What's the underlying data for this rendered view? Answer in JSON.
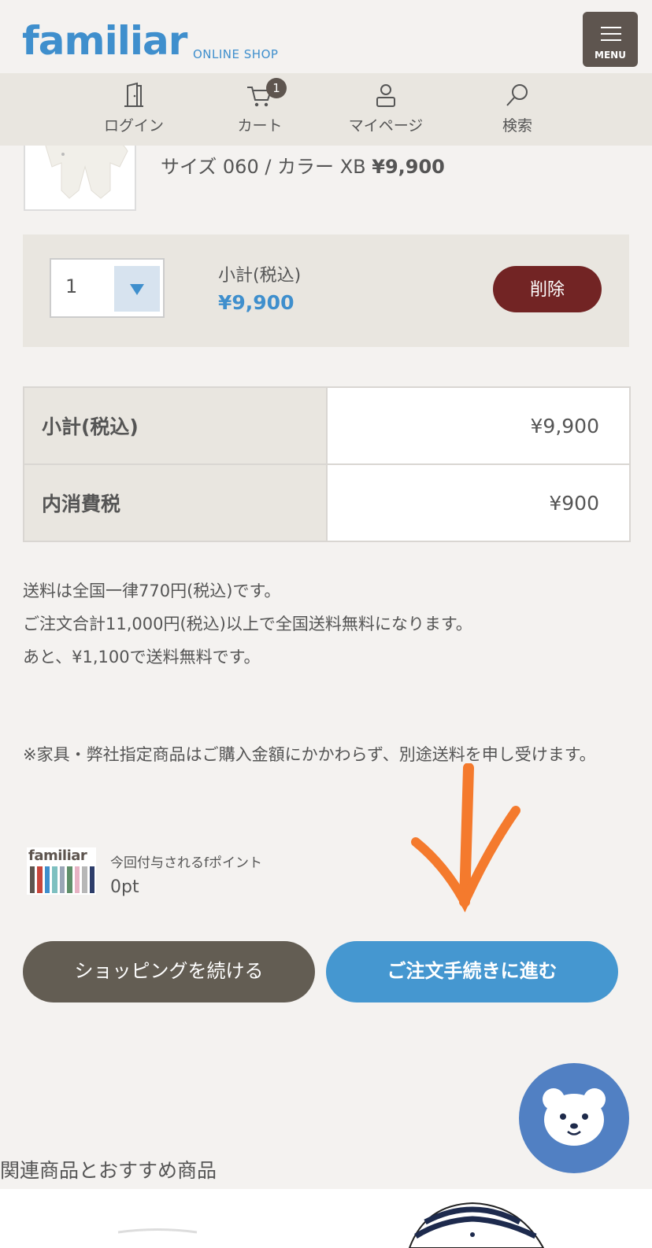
{
  "header": {
    "logo": "familiar",
    "logo_sub": "ONLINE SHOP",
    "menu_label": "MENU"
  },
  "nav": {
    "items": [
      {
        "label": "ログイン",
        "icon": "door-icon"
      },
      {
        "label": "カート",
        "icon": "cart-icon",
        "badge": "1"
      },
      {
        "label": "マイページ",
        "icon": "user-icon"
      },
      {
        "label": "検索",
        "icon": "search-icon"
      }
    ]
  },
  "product": {
    "variant_text": "サイズ 060 / カラー XB",
    "price": "¥9,900"
  },
  "cart_row": {
    "quantity": "1",
    "subtotal_label": "小計(税込)",
    "subtotal_value": "¥9,900",
    "delete_label": "削除"
  },
  "summary": {
    "rows": [
      {
        "label": "小計(税込)",
        "value": "¥9,900"
      },
      {
        "label": "内消費税",
        "value": "¥900"
      }
    ]
  },
  "shipping_notes": [
    "送料は全国一律770円(税込)です。",
    "ご注文合計11,000円(税込)以上で全国送料無料になります。",
    "あと、¥1,100で送料無料です。"
  ],
  "furniture_note": "※家具・弊社指定商品はご購入金額にかかわらず、別途送料を申し受けます。",
  "points": {
    "logo_text": "familiar",
    "label": "今回付与されるfポイント",
    "value": "0pt"
  },
  "buttons": {
    "continue_label": "ショッピングを続ける",
    "order_label": "ご注文手続きに進む"
  },
  "related_title": "関連商品とおすすめ商品",
  "colors": {
    "brand_blue": "#3f8fcd",
    "order_button": "#4597d0",
    "delete_button": "#722424",
    "continue_button": "#635d53",
    "annotation_arrow": "#f47a2d"
  }
}
